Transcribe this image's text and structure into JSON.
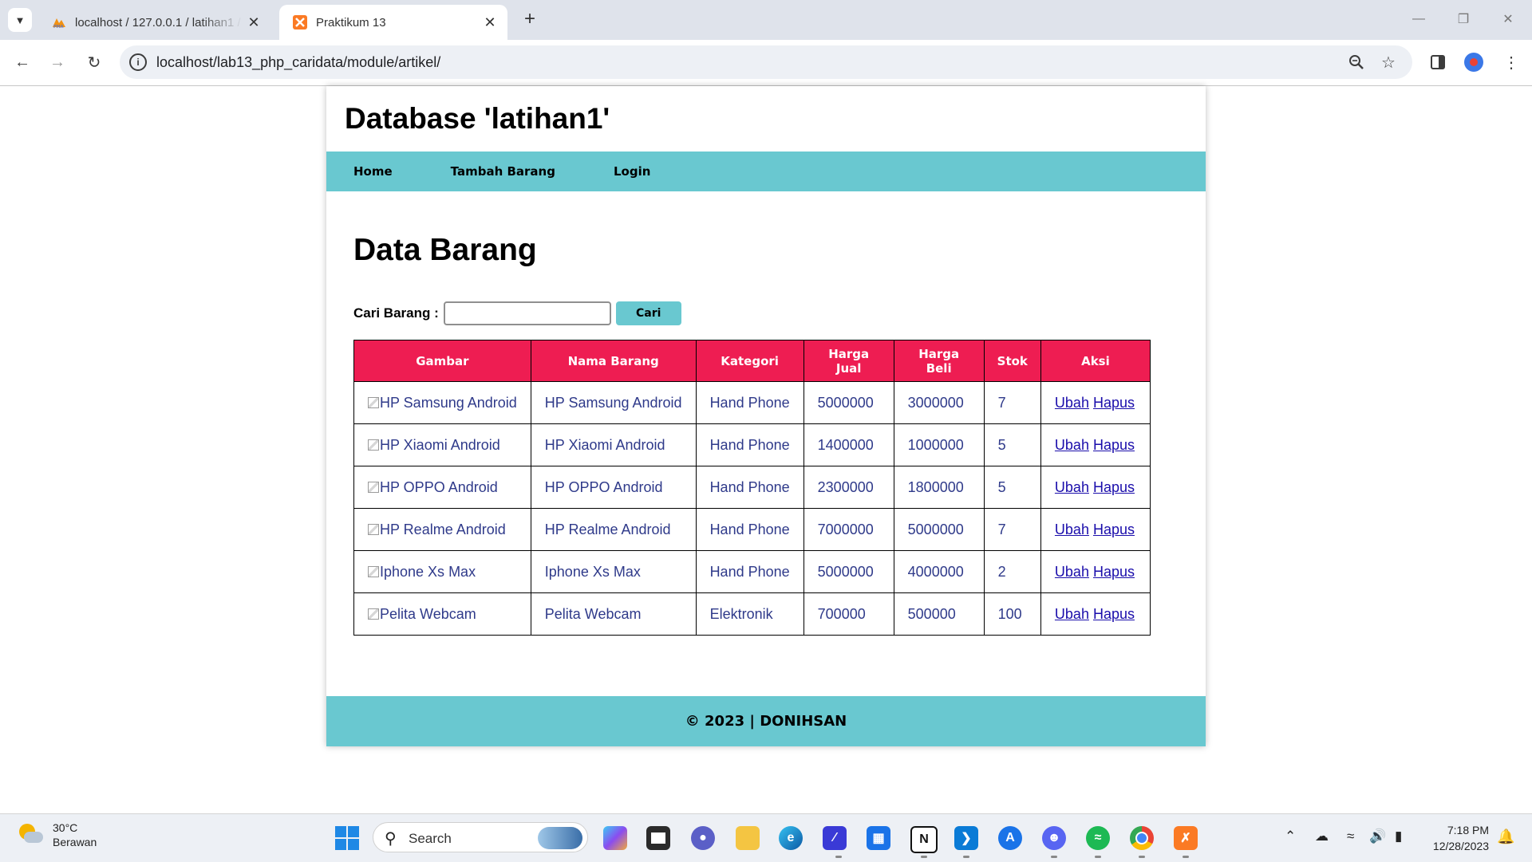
{
  "browser": {
    "tabs": [
      {
        "title": "localhost / 127.0.0.1 / latihan1 / ",
        "active": false
      },
      {
        "title": "Praktikum 13",
        "active": true
      }
    ],
    "url": "localhost/lab13_php_caridata/module/artikel/"
  },
  "site": {
    "title": "Database 'latihan1'",
    "nav": [
      "Home",
      "Tambah Barang",
      "Login"
    ],
    "page_title": "Data Barang",
    "search": {
      "label": "Cari Barang :",
      "value": "",
      "button": "Cari"
    },
    "table": {
      "headers": [
        "Gambar",
        "Nama Barang",
        "Kategori",
        "Harga Jual",
        "Harga Beli",
        "Stok",
        "Aksi"
      ],
      "rows": [
        {
          "gambar": "HP Samsung Android",
          "nama": "HP Samsung Android",
          "kategori": "Hand Phone",
          "harga_jual": "5000000",
          "harga_beli": "3000000",
          "stok": "7",
          "ubah": "Ubah",
          "hapus": "Hapus"
        },
        {
          "gambar": "HP Xiaomi Android",
          "nama": "HP Xiaomi Android",
          "kategori": "Hand Phone",
          "harga_jual": "1400000",
          "harga_beli": "1000000",
          "stok": "5",
          "ubah": "Ubah",
          "hapus": "Hapus"
        },
        {
          "gambar": "HP OPPO Android",
          "nama": "HP OPPO Android",
          "kategori": "Hand Phone",
          "harga_jual": "2300000",
          "harga_beli": "1800000",
          "stok": "5",
          "ubah": "Ubah",
          "hapus": "Hapus"
        },
        {
          "gambar": "HP Realme Android",
          "nama": "HP Realme Android",
          "kategori": "Hand Phone",
          "harga_jual": "7000000",
          "harga_beli": "5000000",
          "stok": "7",
          "ubah": "Ubah",
          "hapus": "Hapus"
        },
        {
          "gambar": "Iphone Xs Max",
          "nama": "Iphone Xs Max",
          "kategori": "Hand Phone",
          "harga_jual": "5000000",
          "harga_beli": "4000000",
          "stok": "2",
          "ubah": "Ubah",
          "hapus": "Hapus"
        },
        {
          "gambar": "Pelita Webcam",
          "nama": "Pelita Webcam",
          "kategori": "Elektronik",
          "harga_jual": "700000",
          "harga_beli": "500000",
          "stok": "100",
          "ubah": "Ubah",
          "hapus": "Hapus"
        }
      ]
    },
    "footer": "© 2023 | DONIHSAN"
  },
  "taskbar": {
    "weather": {
      "temp": "30°C",
      "desc": "Berawan"
    },
    "search_placeholder": "Search",
    "apps": [
      "copilot-icon",
      "terminal-icon",
      "chat-icon",
      "file-explorer-icon",
      "edge-icon",
      "editor-icon",
      "store-icon",
      "notion-icon",
      "vscode-icon",
      "app-icon",
      "discord-icon",
      "spotify-icon",
      "chrome-icon",
      "xampp-icon"
    ],
    "time": "7:18 PM",
    "date": "12/28/2023"
  },
  "colors": {
    "nav_bg": "#69c8d0",
    "table_header_bg": "#ee1d52",
    "cell_text": "#2f3a8a",
    "link": "#1a0dab"
  }
}
